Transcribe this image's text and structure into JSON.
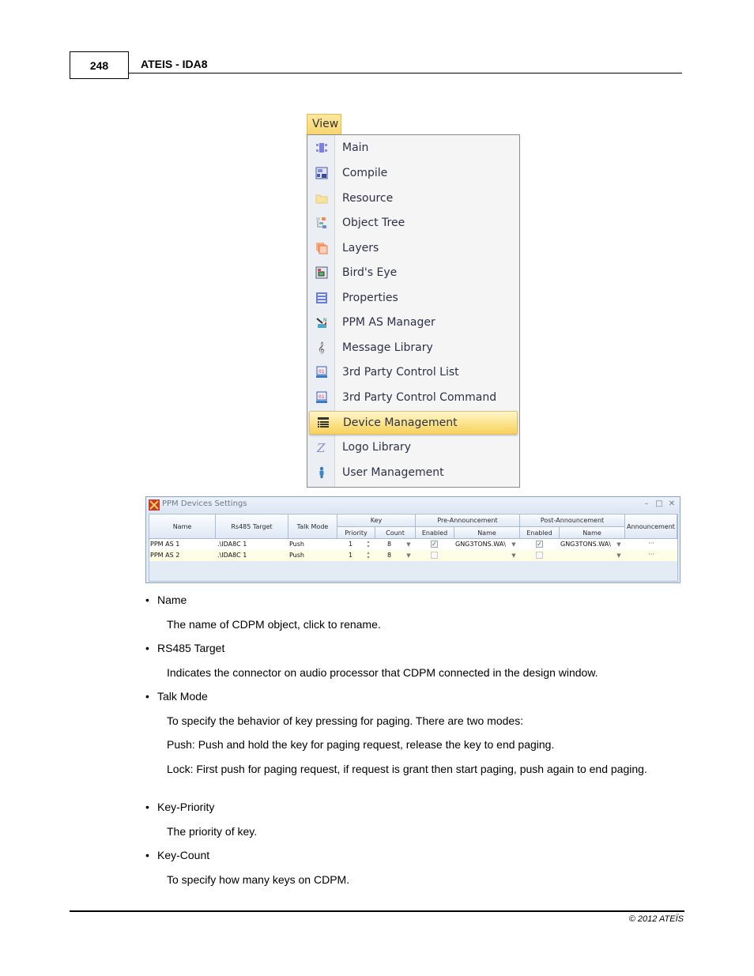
{
  "header": {
    "page_number": "248",
    "doc_title": "ATEIS - IDA8"
  },
  "view_menu": {
    "tab_label": "View",
    "items": [
      {
        "label": "Main",
        "icon": "main-icon"
      },
      {
        "label": "Compile",
        "icon": "compile-icon"
      },
      {
        "label": "Resource",
        "icon": "folder-icon"
      },
      {
        "label": "Object Tree",
        "icon": "tree-icon"
      },
      {
        "label": "Layers",
        "icon": "layers-icon"
      },
      {
        "label": "Bird's Eye",
        "icon": "birds-eye-icon"
      },
      {
        "label": "Properties",
        "icon": "properties-icon"
      },
      {
        "label": "PPM AS Manager",
        "icon": "microphone-icon"
      },
      {
        "label": "Message Library",
        "icon": "treble-clef-icon"
      },
      {
        "label": "3rd Party Control List",
        "icon": "monitor-icon"
      },
      {
        "label": "3rd Party Control Command",
        "icon": "monitor-icon"
      },
      {
        "label": "Device Management",
        "icon": "list-icon",
        "highlighted": true
      },
      {
        "label": "Logo Library",
        "icon": "logo-icon"
      },
      {
        "label": "User Management",
        "icon": "user-icon"
      }
    ]
  },
  "dialog": {
    "title": "PPM Devices Settings",
    "controls": {
      "minimize": "–",
      "maximize": "□",
      "close": "✕"
    },
    "columns": {
      "name": "Name",
      "rs485": "Rs485 Target",
      "talk_mode": "Talk Mode",
      "key": "Key",
      "key_priority": "Priority",
      "key_count": "Count",
      "pre": "Pre-Announcement",
      "pre_enabled": "Enabled",
      "pre_name": "Name",
      "post": "Post-Announcement",
      "post_enabled": "Enabled",
      "post_name": "Name",
      "announcement": "Announcement"
    },
    "rows": [
      {
        "name": "PPM AS 1",
        "rs485": ".\\IDA8C 1",
        "talk_mode": "Push",
        "priority": "1",
        "count": "8",
        "pre_enabled": true,
        "pre_name": "GNG3TONS.WA\\",
        "post_enabled": true,
        "post_name": "GNG3TONS.WA\\",
        "announcement": "···"
      },
      {
        "name": "PPM AS 2",
        "rs485": ".\\IDA8C 1",
        "talk_mode": "Push",
        "priority": "1",
        "count": "8",
        "pre_enabled": false,
        "pre_name": "",
        "post_enabled": false,
        "post_name": "",
        "announcement": "···"
      }
    ]
  },
  "body": {
    "sections": [
      {
        "bullet": "Name",
        "paragraphs": [
          "The name of CDPM object, click to rename."
        ]
      },
      {
        "bullet": "RS485 Target",
        "paragraphs": [
          "Indicates the connector on audio processor that CDPM connected in the design window."
        ]
      },
      {
        "bullet": "Talk Mode",
        "paragraphs": [
          "To specify the behavior of key pressing for paging. There are two modes:",
          "Push: Push and hold the key for paging request, release the key to end paging.",
          "Lock: First push for paging request, if request is grant then start paging, push again to end paging."
        ]
      },
      {
        "bullet": "Key-Priority",
        "paragraphs": [
          "The priority of key."
        ]
      },
      {
        "bullet": "Key-Count",
        "paragraphs": [
          "To specify how many keys on CDPM."
        ]
      }
    ]
  },
  "footer": {
    "copyright": "© 2012 ATEÏS"
  }
}
